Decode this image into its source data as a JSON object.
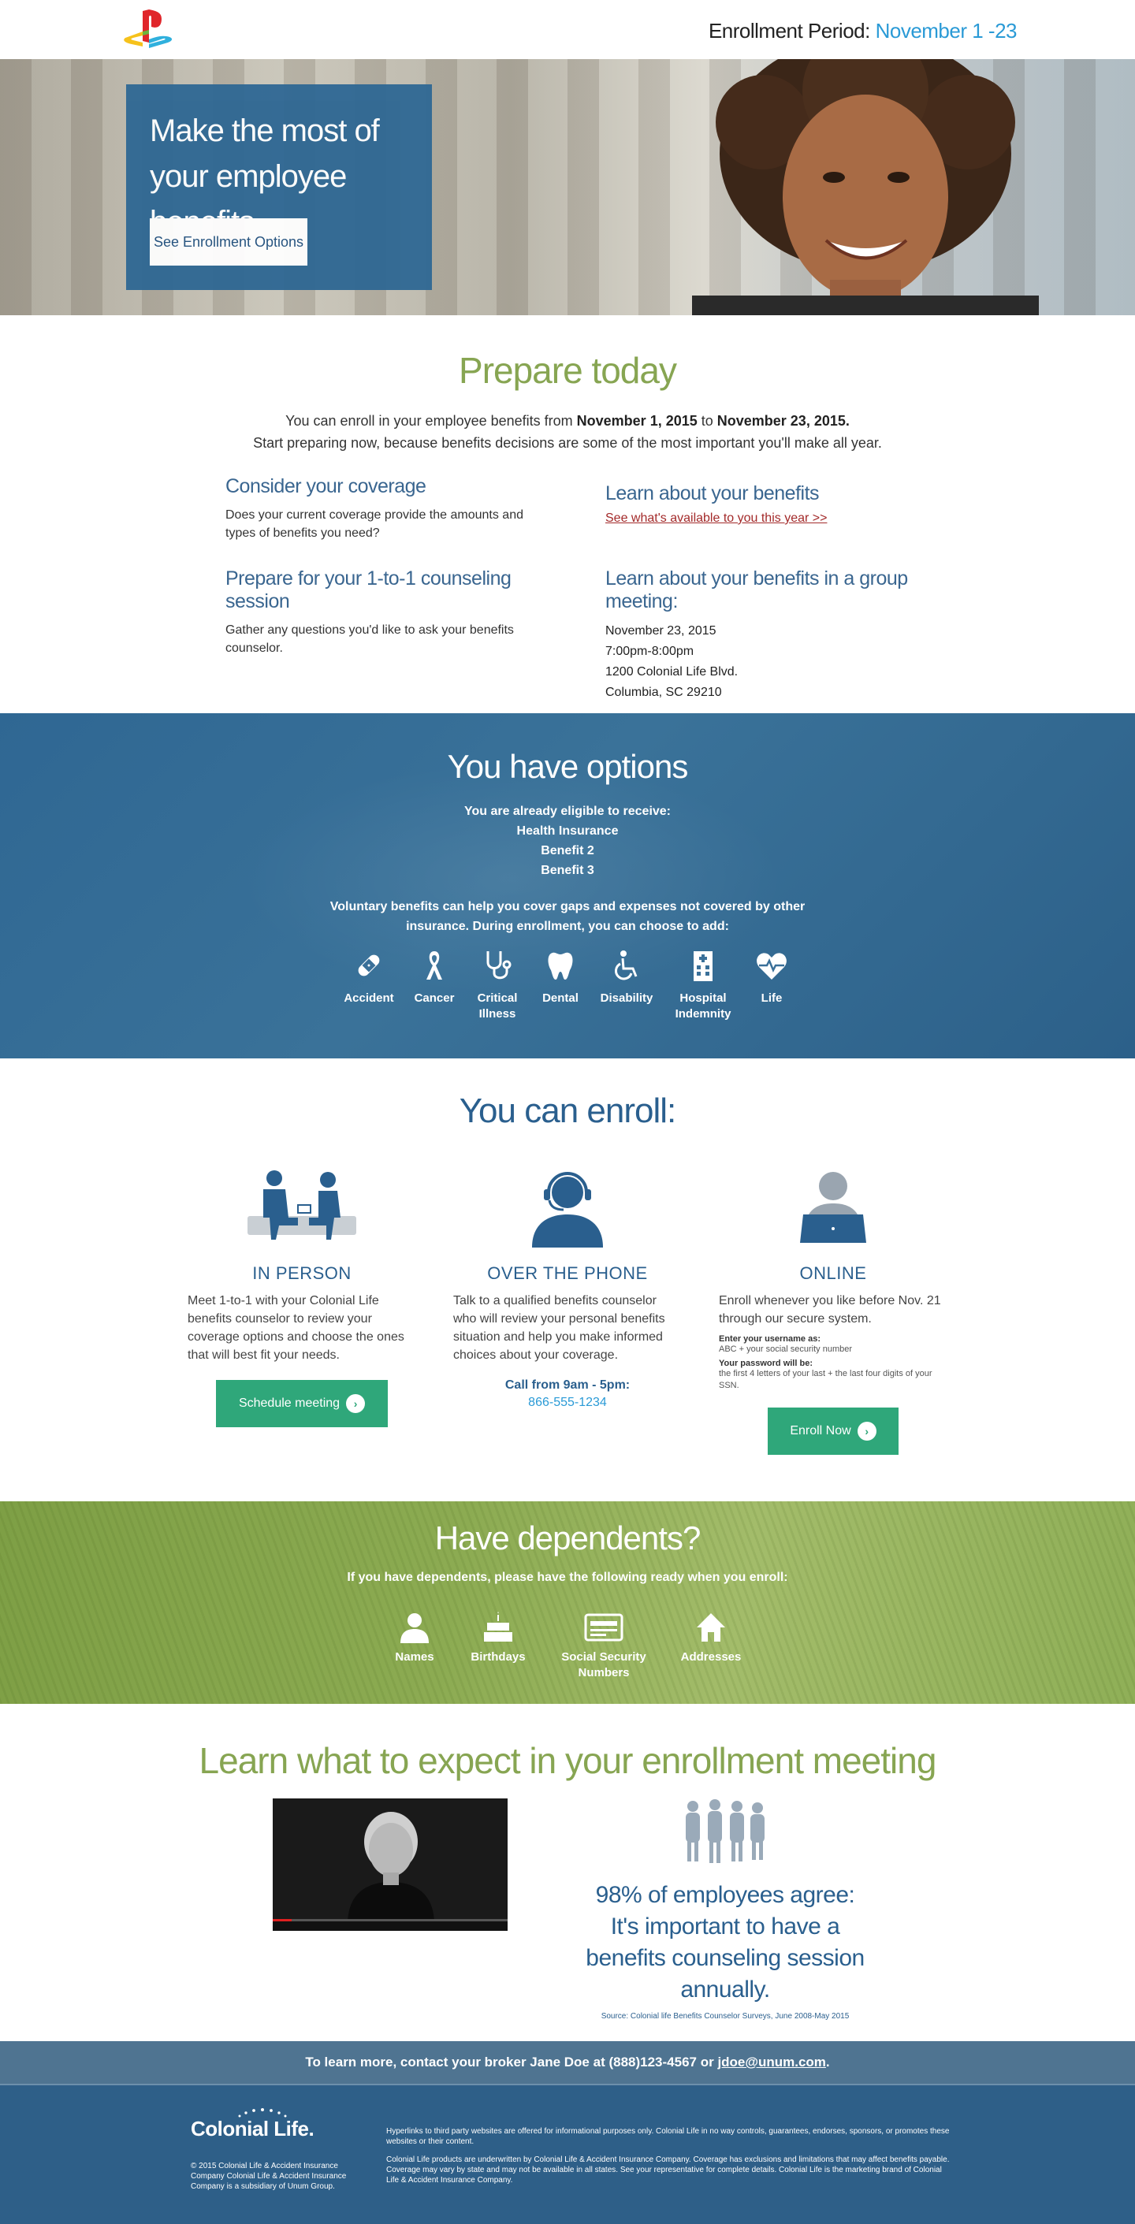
{
  "header": {
    "enroll_label": "Enrollment Period:",
    "enroll_dates": "November 1 -23"
  },
  "hero": {
    "title": "Make the most of your employee benefits",
    "button": "See Enrollment Options"
  },
  "prepare": {
    "title": "Prepare today",
    "intro_pre": "You can enroll in your employee benefits from ",
    "intro_from": "November 1, 2015",
    "intro_to_word": " to ",
    "intro_to": "November 23, 2015.",
    "intro_line2": "Start preparing now, because benefits decisions are some of the most important you'll make all year.",
    "coverage_h": "Consider your coverage",
    "coverage_p": "Does your current coverage provide the amounts and types of benefits you need?",
    "counsel_h": "Prepare for your 1-to-1 counseling session",
    "counsel_p": "Gather any questions you'd like to ask your benefits counselor.",
    "learn_h": "Learn about your benefits",
    "learn_link": "See what's available to you this year >>",
    "group_h": "Learn about your benefits in a group meeting:",
    "group_date": "November 23, 2015",
    "group_time": "7:00pm-8:00pm",
    "group_street": "1200 Colonial Life Blvd.",
    "group_city": "Columbia, SC 29210"
  },
  "options": {
    "title": "You have options",
    "eligible_label": "You are already eligible to receive:",
    "eligible": [
      "Health Insurance",
      "Benefit 2",
      "Benefit 3"
    ],
    "voluntary": "Voluntary benefits can help you cover gaps and expenses not covered by other insurance. During enrollment, you can choose to add:",
    "benefits": [
      "Accident",
      "Cancer",
      "Critical Illness",
      "Dental",
      "Disability",
      "Hospital Indemnity",
      "Life"
    ]
  },
  "enroll": {
    "title": "You can enroll:",
    "in_person": {
      "title": "IN PERSON",
      "text": "Meet 1-to-1 with your Colonial Life benefits counselor to review your coverage options and choose the ones that will best fit your needs.",
      "button": "Schedule meeting"
    },
    "phone": {
      "title": "OVER THE PHONE",
      "text": "Talk to a qualified benefits counselor who will review your personal benefits situation and help you make informed choices about your coverage.",
      "call_label": "Call from 9am - 5pm:",
      "number": "866-555-1234"
    },
    "online": {
      "title": "ONLINE",
      "text": "Enroll whenever you like before Nov. 21 through our secure system.",
      "username_h": "Enter your username as:",
      "username_p": "ABC + your social security number",
      "password_h": "Your password will be:",
      "password_p": "the first 4 letters of your last + the last four digits of your SSN.",
      "button": "Enroll Now"
    }
  },
  "dependents": {
    "title": "Have dependents?",
    "subtitle": "If you have dependents, please have the following ready when you enroll:",
    "items": [
      "Names",
      "Birthdays",
      "Social Security Numbers",
      "Addresses"
    ]
  },
  "learn": {
    "title": "Learn what to expect in your enrollment meeting",
    "stat": "98% of employees agree: It's important to have a benefits counseling session annually.",
    "source": "Source:  Colonial life Benefits Counselor Surveys, June 2008-May 2015"
  },
  "contact": {
    "text": "To learn more,  contact your broker Jane Doe at (888)123-4567 or ",
    "email": "jdoe@unum.com",
    "end": "."
  },
  "footer": {
    "logo": "Colonial Life.",
    "copyright": "© 2015 Colonial Life & Accident Insurance Company Colonial Life & Accident Insurance Company is a subsidiary of Unum Group.",
    "disclaimer1": "Hyperlinks to third party websites are offered for informational purposes only. Colonial Life in no way controls, guarantees, endorses, sponsors, or promotes these websites or their content.",
    "disclaimer2": "Colonial Life products are underwritten by Colonial Life & Accident Insurance Company. Coverage has exclusions and limitations that may affect benefits payable. Coverage may vary by state and may not be available in all states. See your representative for complete details. Colonial Life is the marketing brand of Colonial Life & Accident Insurance Company."
  }
}
